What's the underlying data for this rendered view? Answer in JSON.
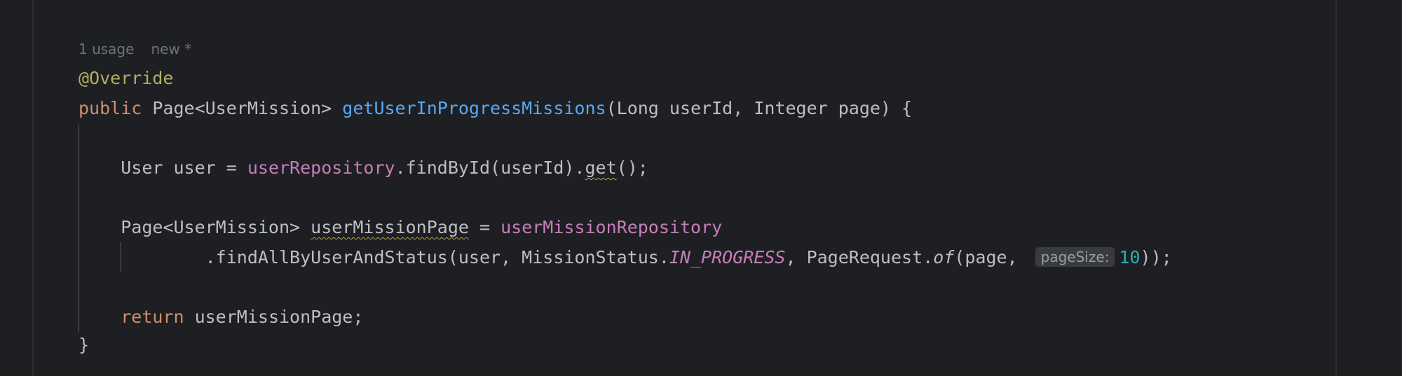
{
  "hints": {
    "usages": "1 usage",
    "author": "new *"
  },
  "code": {
    "annotation": "@Override",
    "signature": {
      "kw_public": "public",
      "return_type": " Page<UserMission> ",
      "method_name": "getUserInProgressMissions",
      "params": "(Long userId, Integer page) {"
    },
    "line_user": {
      "indent": "    ",
      "decl": "User user = ",
      "field": "userRepository",
      "call": ".findById(userId).",
      "get": "get",
      "tail": "();"
    },
    "line_page": {
      "indent": "    ",
      "type": "Page<UserMission> ",
      "var": "userMissionPage",
      "eq": " = ",
      "field": "userMissionRepository"
    },
    "line_find": {
      "indent": "            ",
      "call": ".findAllByUserAndStatus(user, MissionStatus.",
      "const": "IN_PROGRESS",
      "mid": ", PageRequest.",
      "of": "of",
      "args": "(page, ",
      "inlay": "pageSize:",
      "num": "10",
      "tail": "));"
    },
    "line_return": {
      "indent": "    ",
      "kw": "return",
      "rest": " userMissionPage;"
    },
    "closing": "}"
  }
}
